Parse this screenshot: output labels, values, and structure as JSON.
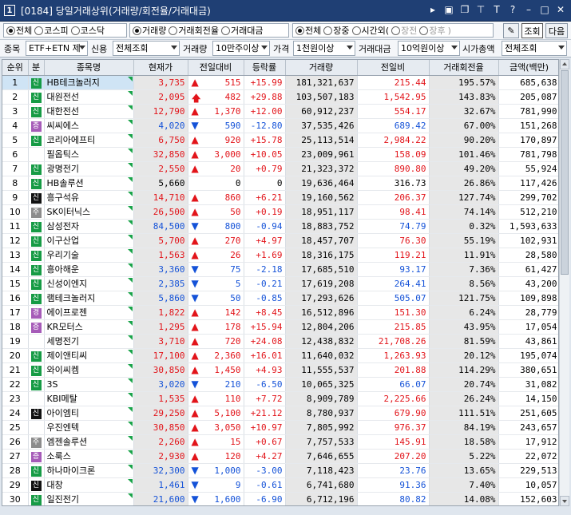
{
  "window": {
    "number": "1",
    "title": "[0184] 당일거래상위(거래량/회전율/거래대금)",
    "icons": [
      "menu-arrow-icon",
      "m-icon",
      "window-restore-icon",
      "pin-icon",
      "font-size-icon",
      "help-icon",
      "minimize-icon",
      "maximize-icon",
      "close-icon"
    ]
  },
  "filters": {
    "market": {
      "options": [
        "전체",
        "코스피",
        "코스닥"
      ],
      "selected": "전체"
    },
    "sort": {
      "options": [
        "거래량",
        "거래회전율",
        "거래대금"
      ],
      "selected": "거래량"
    },
    "session": {
      "options": [
        "전체",
        "장중",
        "시간외("
      ],
      "selected": "전체"
    },
    "session_sub": {
      "options": [
        "장전",
        "장후"
      ],
      "close": ")"
    },
    "buttons": {
      "query": "조회",
      "next": "다음"
    },
    "row2": {
      "item_label": "종목",
      "item_value": "ETF+ETN 제",
      "credit_label": "신용",
      "credit_value": "전체조회",
      "volume_label": "거래량",
      "volume_value": "10만주이상",
      "price_label": "가격",
      "price_value": "1천원이상",
      "amount_label": "거래대금",
      "amount_value": "10억원이상",
      "mktcap_label": "시가총액",
      "mktcap_value": "전체조회"
    }
  },
  "colors": {
    "up": "#e2141a",
    "down": "#1452d8",
    "badge_green": "#169b45",
    "badge_black": "#111111",
    "badge_purple": "#a65bb8",
    "badge_gray": "#8c8c8c"
  },
  "table": {
    "headers": [
      "순위",
      "분",
      "종목명",
      "현재가",
      "전일대비",
      "등락률",
      "거래량",
      "전일비",
      "거래회전율",
      "금액(백만)"
    ],
    "rows": [
      {
        "rank": "1",
        "cat": "신",
        "cat_color": "green",
        "name": "HB테크놀러지",
        "price": "3,735",
        "dir": "up",
        "chg": "515",
        "rate": "+15.99",
        "vol": "181,321,637",
        "prev": "215.44",
        "turn": "195.57%",
        "amt": "685,638"
      },
      {
        "rank": "2",
        "cat": "신",
        "cat_color": "green",
        "name": "대원전선",
        "price": "2,095",
        "dir": "upper",
        "chg": "482",
        "rate": "+29.88",
        "vol": "103,507,183",
        "prev": "1,542.95",
        "turn": "143.83%",
        "amt": "205,087"
      },
      {
        "rank": "3",
        "cat": "신",
        "cat_color": "green",
        "name": "대한전선",
        "price": "12,790",
        "dir": "up",
        "chg": "1,370",
        "rate": "+12.00",
        "vol": "60,912,237",
        "prev": "554.17",
        "turn": "32.67%",
        "amt": "781,990"
      },
      {
        "rank": "4",
        "cat": "증",
        "cat_color": "purple",
        "name": "씨씨에스",
        "price": "4,020",
        "dir": "down",
        "chg": "590",
        "rate": "-12.80",
        "vol": "37,535,426",
        "prev": "689.42",
        "turn": "67.00%",
        "amt": "151,268"
      },
      {
        "rank": "5",
        "cat": "신",
        "cat_color": "green",
        "name": "코리아에프티",
        "price": "6,750",
        "dir": "up",
        "chg": "920",
        "rate": "+15.78",
        "vol": "25,113,514",
        "prev": "2,984.22",
        "turn": "90.20%",
        "amt": "170,897"
      },
      {
        "rank": "6",
        "cat": "",
        "cat_color": "",
        "name": "필옵틱스",
        "price": "32,850",
        "dir": "up",
        "chg": "3,000",
        "rate": "+10.05",
        "vol": "23,009,961",
        "prev": "158.09",
        "turn": "101.46%",
        "amt": "781,798"
      },
      {
        "rank": "7",
        "cat": "신",
        "cat_color": "green",
        "name": "광명전기",
        "price": "2,550",
        "dir": "up",
        "chg": "20",
        "rate": "+0.79",
        "vol": "21,323,372",
        "prev": "890.80",
        "turn": "49.20%",
        "amt": "55,924"
      },
      {
        "rank": "8",
        "cat": "신",
        "cat_color": "green",
        "name": "HB솔루션",
        "price": "5,660",
        "dir": "flat",
        "chg": "0",
        "rate": "0",
        "vol": "19,636,464",
        "prev": "316.73",
        "turn": "26.86%",
        "amt": "117,426"
      },
      {
        "rank": "9",
        "cat": "신",
        "cat_color": "black",
        "name": "흥구석유",
        "price": "14,710",
        "dir": "up",
        "chg": "860",
        "rate": "+6.21",
        "vol": "19,160,562",
        "prev": "206.37",
        "turn": "127.74%",
        "amt": "299,702"
      },
      {
        "rank": "10",
        "cat": "주",
        "cat_color": "gray",
        "name": "SK이터닉스",
        "price": "26,500",
        "dir": "up",
        "chg": "50",
        "rate": "+0.19",
        "vol": "18,951,117",
        "prev": "98.41",
        "turn": "74.14%",
        "amt": "512,210"
      },
      {
        "rank": "11",
        "cat": "신",
        "cat_color": "green",
        "name": "삼성전자",
        "price": "84,500",
        "dir": "down",
        "chg": "800",
        "rate": "-0.94",
        "vol": "18,883,752",
        "prev": "74.79",
        "turn": "0.32%",
        "amt": "1,593,633"
      },
      {
        "rank": "12",
        "cat": "신",
        "cat_color": "green",
        "name": "이구산업",
        "price": "5,700",
        "dir": "up",
        "chg": "270",
        "rate": "+4.97",
        "vol": "18,457,707",
        "prev": "76.30",
        "turn": "55.19%",
        "amt": "102,931"
      },
      {
        "rank": "13",
        "cat": "신",
        "cat_color": "green",
        "name": "우리기술",
        "price": "1,563",
        "dir": "up",
        "chg": "26",
        "rate": "+1.69",
        "vol": "18,316,175",
        "prev": "119.21",
        "turn": "11.91%",
        "amt": "28,580"
      },
      {
        "rank": "14",
        "cat": "신",
        "cat_color": "green",
        "name": "흥아해운",
        "price": "3,360",
        "dir": "down",
        "chg": "75",
        "rate": "-2.18",
        "vol": "17,685,510",
        "prev": "93.17",
        "turn": "7.36%",
        "amt": "61,427"
      },
      {
        "rank": "15",
        "cat": "신",
        "cat_color": "green",
        "name": "신성이엔지",
        "price": "2,385",
        "dir": "down",
        "chg": "5",
        "rate": "-0.21",
        "vol": "17,619,208",
        "prev": "264.41",
        "turn": "8.56%",
        "amt": "43,200"
      },
      {
        "rank": "16",
        "cat": "신",
        "cat_color": "green",
        "name": "램테크놀러지",
        "price": "5,860",
        "dir": "down",
        "chg": "50",
        "rate": "-0.85",
        "vol": "17,293,626",
        "prev": "505.07",
        "turn": "121.75%",
        "amt": "109,898"
      },
      {
        "rank": "17",
        "cat": "경",
        "cat_color": "purple",
        "name": "에이프로젠",
        "price": "1,822",
        "dir": "up",
        "chg": "142",
        "rate": "+8.45",
        "vol": "16,512,896",
        "prev": "151.30",
        "turn": "6.24%",
        "amt": "28,779"
      },
      {
        "rank": "18",
        "cat": "증",
        "cat_color": "purple",
        "name": "KR모터스",
        "price": "1,295",
        "dir": "up",
        "chg": "178",
        "rate": "+15.94",
        "vol": "12,804,206",
        "prev": "215.85",
        "turn": "43.95%",
        "amt": "17,054"
      },
      {
        "rank": "19",
        "cat": "",
        "cat_color": "",
        "name": "세명전기",
        "price": "3,710",
        "dir": "up",
        "chg": "720",
        "rate": "+24.08",
        "vol": "12,438,832",
        "prev": "21,708.26",
        "turn": "81.59%",
        "amt": "43,861"
      },
      {
        "rank": "20",
        "cat": "신",
        "cat_color": "green",
        "name": "제이앤티씨",
        "price": "17,100",
        "dir": "up",
        "chg": "2,360",
        "rate": "+16.01",
        "vol": "11,640,032",
        "prev": "1,263.93",
        "turn": "20.12%",
        "amt": "195,074"
      },
      {
        "rank": "21",
        "cat": "신",
        "cat_color": "green",
        "name": "와이씨켐",
        "price": "30,850",
        "dir": "up",
        "chg": "1,450",
        "rate": "+4.93",
        "vol": "11,555,537",
        "prev": "201.88",
        "turn": "114.29%",
        "amt": "380,651"
      },
      {
        "rank": "22",
        "cat": "신",
        "cat_color": "green",
        "name": "3S",
        "price": "3,020",
        "dir": "down",
        "chg": "210",
        "rate": "-6.50",
        "vol": "10,065,325",
        "prev": "66.07",
        "turn": "20.74%",
        "amt": "31,082"
      },
      {
        "rank": "23",
        "cat": "",
        "cat_color": "",
        "name": "KBI메탈",
        "price": "1,535",
        "dir": "up",
        "chg": "110",
        "rate": "+7.72",
        "vol": "8,909,789",
        "prev": "2,225.66",
        "turn": "26.24%",
        "amt": "14,150"
      },
      {
        "rank": "24",
        "cat": "신",
        "cat_color": "black",
        "name": "아이엠티",
        "price": "29,250",
        "dir": "up",
        "chg": "5,100",
        "rate": "+21.12",
        "vol": "8,780,937",
        "prev": "679.90",
        "turn": "111.51%",
        "amt": "251,605"
      },
      {
        "rank": "25",
        "cat": "",
        "cat_color": "",
        "name": "우진엔텍",
        "price": "30,850",
        "dir": "up",
        "chg": "3,050",
        "rate": "+10.97",
        "vol": "7,805,992",
        "prev": "976.37",
        "turn": "84.19%",
        "amt": "243,657"
      },
      {
        "rank": "26",
        "cat": "주",
        "cat_color": "gray",
        "name": "엠젠솔루션",
        "price": "2,260",
        "dir": "up",
        "chg": "15",
        "rate": "+0.67",
        "vol": "7,757,533",
        "prev": "145.91",
        "turn": "18.58%",
        "amt": "17,912"
      },
      {
        "rank": "27",
        "cat": "증",
        "cat_color": "purple",
        "name": "소룩스",
        "price": "2,930",
        "dir": "up",
        "chg": "120",
        "rate": "+4.27",
        "vol": "7,646,655",
        "prev": "207.20",
        "turn": "5.22%",
        "amt": "22,072"
      },
      {
        "rank": "28",
        "cat": "신",
        "cat_color": "green",
        "name": "하나마이크론",
        "price": "32,300",
        "dir": "down",
        "chg": "1,000",
        "rate": "-3.00",
        "vol": "7,118,423",
        "prev": "23.76",
        "turn": "13.65%",
        "amt": "229,513"
      },
      {
        "rank": "29",
        "cat": "신",
        "cat_color": "black",
        "name": "대창",
        "price": "1,461",
        "dir": "down",
        "chg": "9",
        "rate": "-0.61",
        "vol": "6,741,680",
        "prev": "91.36",
        "turn": "7.40%",
        "amt": "10,057"
      },
      {
        "rank": "30",
        "cat": "신",
        "cat_color": "green",
        "name": "일진전기",
        "price": "21,600",
        "dir": "down",
        "chg": "1,600",
        "rate": "-6.90",
        "vol": "6,712,196",
        "prev": "80.82",
        "turn": "14.08%",
        "amt": "152,603"
      }
    ]
  }
}
